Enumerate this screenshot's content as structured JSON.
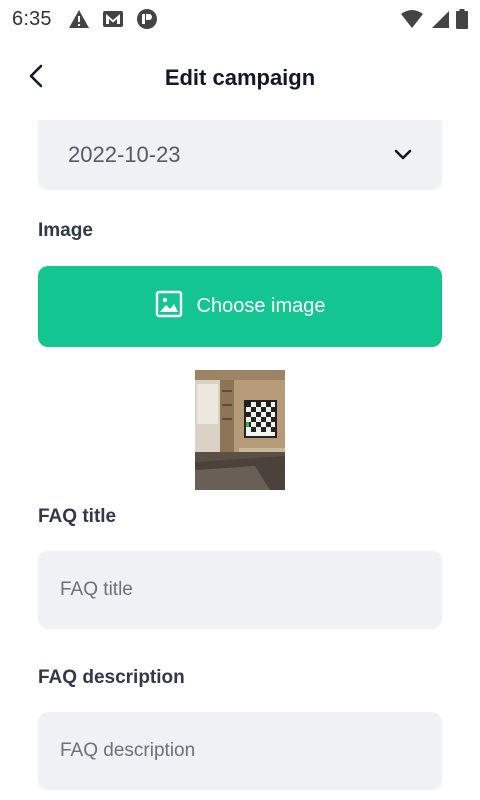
{
  "status_bar": {
    "time": "6:35",
    "left_icons": [
      "warning-icon",
      "gmail-icon",
      "app-notification-icon"
    ],
    "right_icons": [
      "wifi-icon",
      "cell-signal-icon",
      "battery-icon"
    ]
  },
  "app_bar": {
    "title": "Edit campaign",
    "back_icon": "arrow-back-icon"
  },
  "form": {
    "date": {
      "value": "2022-10-23",
      "icon": "chevron-down-icon"
    },
    "image": {
      "label": "Image",
      "button_label": "Choose image",
      "button_icon": "image-icon",
      "button_color": "#12c591"
    },
    "faq_title": {
      "label": "FAQ title",
      "placeholder": "FAQ title",
      "value": ""
    },
    "faq_description": {
      "label": "FAQ description",
      "placeholder": "FAQ description",
      "value": ""
    }
  }
}
